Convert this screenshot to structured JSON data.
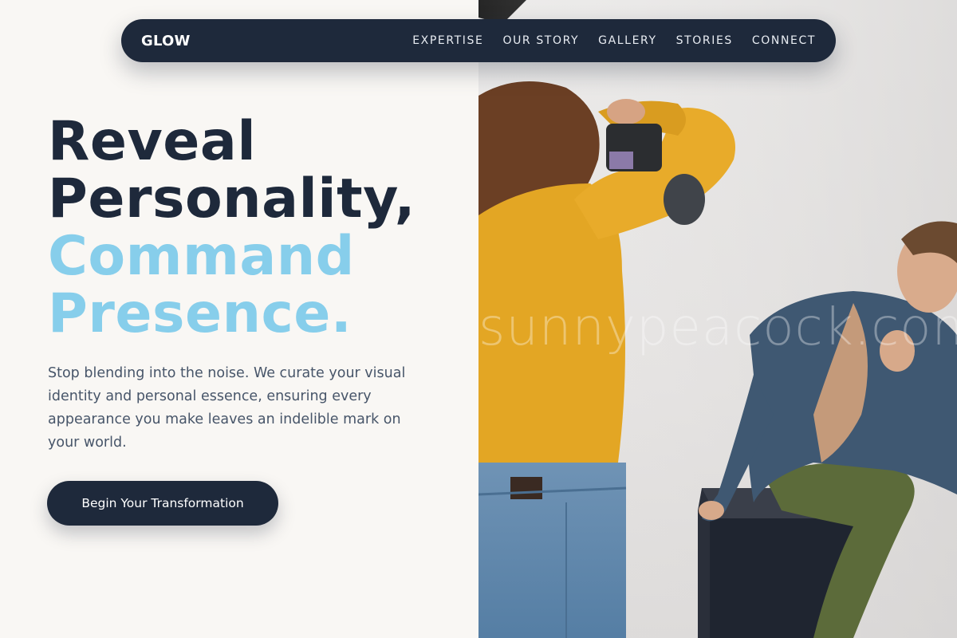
{
  "nav": {
    "logo": "GLOW",
    "links": [
      "EXPERTISE",
      "OUR STORY",
      "GALLERY",
      "STORIES",
      "CONNECT"
    ]
  },
  "hero": {
    "title_lines": [
      "Reveal",
      "Personality,",
      "Command",
      "Presence."
    ],
    "description": "Stop blending into the noise. We curate your visual identity and personal essence, ensuring every appearance you make leaves an indelible mark on your world.",
    "cta_label": "Begin Your Transformation"
  },
  "photo": {
    "watermark": "sunnypeacock.com"
  },
  "colors": {
    "navy": "#1e293b",
    "accent": "#87ceeb",
    "background": "#f9f7f4",
    "body_text": "#475569"
  }
}
